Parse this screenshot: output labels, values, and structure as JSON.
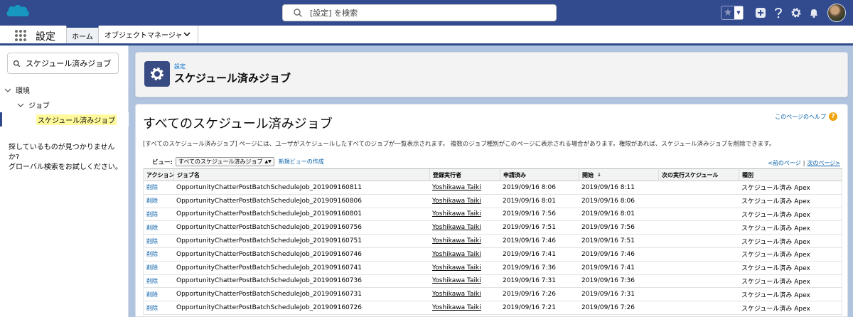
{
  "header": {
    "search_placeholder": "[設定] を検索",
    "brand_color": "#324b8f"
  },
  "nav": {
    "app_name": "設定",
    "tabs": [
      {
        "label": "ホーム"
      },
      {
        "label": "オブジェクトマネージャ"
      }
    ]
  },
  "sidebar": {
    "quick_find_value": "スケジュール済みジョブ",
    "tree": {
      "environment": "環境",
      "jobs": "ジョブ",
      "selected": "スケジュール済みジョブ"
    },
    "help_line1": "探しているものが見つかりませんか?",
    "help_line2": "グローバル検索をお試しください。"
  },
  "page_header": {
    "super_title": "設定",
    "title": "スケジュール済みジョブ"
  },
  "content": {
    "title": "すべてのスケジュール済みジョブ",
    "help_link": "このページのヘルプ",
    "description": "[すべてのスケジュール済みジョブ] ページには、ユーザがスケジュールしたすべてのジョブが一覧表示されます。 複数のジョブ種別がこのページに表示される場合があります。権限があれば、スケジュール済みジョブを削除できます。",
    "view_label": "ビュー:",
    "view_value": "すべてのスケジュール済みジョブ",
    "new_view": "新規ビューの作成",
    "prev_page": "<前のページ",
    "next_page": "次のページ>"
  },
  "table": {
    "columns": [
      "アクション",
      "ジョブ名",
      "登録実行者",
      "申請済み",
      "開始",
      "次の実行スケジュール",
      "種別"
    ],
    "sort_indicator": "↓",
    "rows": [
      {
        "action": "削除",
        "job": "OpportunityChatterPostBatchScheduleJob_201909160811",
        "submitter": "Yoshikawa Taiki",
        "submitted": "2019/09/16 8:06",
        "started": "2019/09/16 8:11",
        "next": "",
        "type": "スケジュール済み Apex"
      },
      {
        "action": "削除",
        "job": "OpportunityChatterPostBatchScheduleJob_201909160806",
        "submitter": "Yoshikawa Taiki",
        "submitted": "2019/09/16 8:01",
        "started": "2019/09/16 8:06",
        "next": "",
        "type": "スケジュール済み Apex"
      },
      {
        "action": "削除",
        "job": "OpportunityChatterPostBatchScheduleJob_201909160801",
        "submitter": "Yoshikawa Taiki",
        "submitted": "2019/09/16 7:56",
        "started": "2019/09/16 8:01",
        "next": "",
        "type": "スケジュール済み Apex"
      },
      {
        "action": "削除",
        "job": "OpportunityChatterPostBatchScheduleJob_201909160756",
        "submitter": "Yoshikawa Taiki",
        "submitted": "2019/09/16 7:51",
        "started": "2019/09/16 7:56",
        "next": "",
        "type": "スケジュール済み Apex"
      },
      {
        "action": "削除",
        "job": "OpportunityChatterPostBatchScheduleJob_201909160751",
        "submitter": "Yoshikawa Taiki",
        "submitted": "2019/09/16 7:46",
        "started": "2019/09/16 7:51",
        "next": "",
        "type": "スケジュール済み Apex"
      },
      {
        "action": "削除",
        "job": "OpportunityChatterPostBatchScheduleJob_201909160746",
        "submitter": "Yoshikawa Taiki",
        "submitted": "2019/09/16 7:41",
        "started": "2019/09/16 7:46",
        "next": "",
        "type": "スケジュール済み Apex"
      },
      {
        "action": "削除",
        "job": "OpportunityChatterPostBatchScheduleJob_201909160741",
        "submitter": "Yoshikawa Taiki",
        "submitted": "2019/09/16 7:36",
        "started": "2019/09/16 7:41",
        "next": "",
        "type": "スケジュール済み Apex"
      },
      {
        "action": "削除",
        "job": "OpportunityChatterPostBatchScheduleJob_201909160736",
        "submitter": "Yoshikawa Taiki",
        "submitted": "2019/09/16 7:31",
        "started": "2019/09/16 7:36",
        "next": "",
        "type": "スケジュール済み Apex"
      },
      {
        "action": "削除",
        "job": "OpportunityChatterPostBatchScheduleJob_201909160731",
        "submitter": "Yoshikawa Taiki",
        "submitted": "2019/09/16 7:26",
        "started": "2019/09/16 7:31",
        "next": "",
        "type": "スケジュール済み Apex"
      },
      {
        "action": "削除",
        "job": "OpportunityChatterPostBatchScheduleJob_201909160726",
        "submitter": "Yoshikawa Taiki",
        "submitted": "2019/09/16 7:21",
        "started": "2019/09/16 7:26",
        "next": "",
        "type": "スケジュール済み Apex"
      }
    ]
  }
}
